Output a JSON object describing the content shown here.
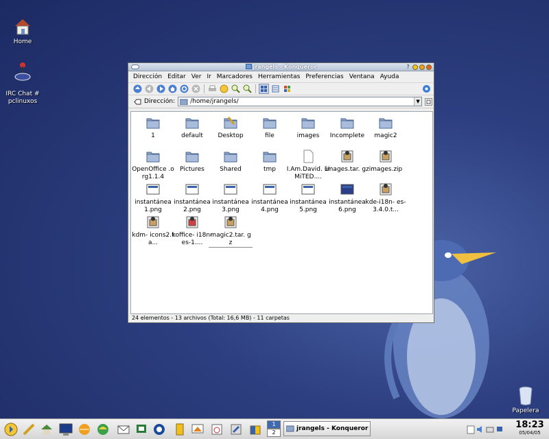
{
  "desktop": {
    "icons": [
      {
        "label": "Home"
      },
      {
        "label": "IRC Chat #\npclinuxos"
      },
      {
        "label": "Papelera"
      }
    ]
  },
  "window": {
    "title": "jrangels - Konqueror",
    "help_button": "?",
    "menu": [
      "Dirección",
      "Editar",
      "Ver",
      "Ir",
      "Marcadores",
      "Herramientas",
      "Preferencias",
      "Ventana",
      "Ayuda"
    ],
    "location_label": "Dirección:",
    "location_value": "/home/jrangels/",
    "files": [
      {
        "label": "1",
        "type": "folder"
      },
      {
        "label": "default",
        "type": "folder"
      },
      {
        "label": "Desktop",
        "type": "desktop-folder"
      },
      {
        "label": "file",
        "type": "folder"
      },
      {
        "label": "images",
        "type": "folder"
      },
      {
        "label": "Incomplete",
        "type": "folder"
      },
      {
        "label": "magic2",
        "type": "folder"
      },
      {
        "label": "OpenOffice .org1.1.4",
        "type": "folder"
      },
      {
        "label": "Pictures",
        "type": "folder"
      },
      {
        "label": "Shared",
        "type": "folder"
      },
      {
        "label": "tmp",
        "type": "folder"
      },
      {
        "label": "I.Am.David. LiMiTED....",
        "type": "document"
      },
      {
        "label": "images.tar. gz",
        "type": "archive"
      },
      {
        "label": "images.zip",
        "type": "archive"
      },
      {
        "label": "instantánea 1.png",
        "type": "image"
      },
      {
        "label": "instantánea 2.png",
        "type": "image"
      },
      {
        "label": "instantánea 3.png",
        "type": "image"
      },
      {
        "label": "instantánea 4.png",
        "type": "image"
      },
      {
        "label": "instantánea 5.png",
        "type": "image"
      },
      {
        "label": "instantánea 6.png",
        "type": "image-dark"
      },
      {
        "label": "kde-i18n- es-3.4.0.t...",
        "type": "archive"
      },
      {
        "label": "kdm- icons2.ta...",
        "type": "archive"
      },
      {
        "label": "koffice- i18n-es-1....",
        "type": "archive-red"
      },
      {
        "label": "magic2.tar. gz",
        "type": "archive"
      }
    ],
    "status": "24 elementos - 13 archivos (Total: 16,6 MB) - 11 carpetas"
  },
  "taskbar": {
    "pager": [
      "1",
      "2"
    ],
    "task_label": "jrangels - Konqueror",
    "clock_time": "18:23",
    "clock_date": "05/04/05"
  },
  "colors": {
    "desktop_bg": "#2d3f80",
    "title_gradient_top": "#dbe3ee",
    "folder": "#8fa6c9"
  }
}
